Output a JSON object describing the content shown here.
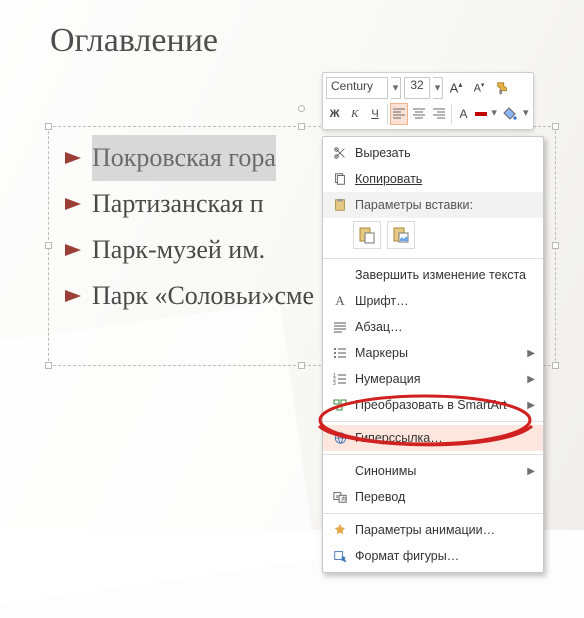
{
  "title": "Оглавление",
  "list": {
    "items": [
      {
        "text": "Покровская гора",
        "selected": true
      },
      {
        "text": "Партизанская п",
        "tail": ""
      },
      {
        "text": "Парк-музей им.",
        "tail": ""
      },
      {
        "text": "Парк «Соловьи»",
        "tail": "                                     сме"
      }
    ]
  },
  "mini_toolbar": {
    "font_name": "Century",
    "font_size": "32",
    "increase_font": "A",
    "decrease_font": "A",
    "bold": "Ж",
    "italic": "К",
    "underline": "Ч",
    "font_color": "#c00000",
    "highlight": "#ffff00"
  },
  "context_menu": {
    "cut": "Вырезать",
    "copy": "Копировать",
    "paste_header": "Параметры вставки:",
    "finish_edit": "Завершить изменение текста",
    "font": "Шрифт…",
    "paragraph": "Абзац…",
    "bullets": "Маркеры",
    "numbering": "Нумерация",
    "smartart": "Преобразовать в SmartArt",
    "hyperlink": "Гиперссылка…",
    "synonyms": "Синонимы",
    "translate": "Перевод",
    "anim": "Параметры анимации…",
    "format": "Формат фигуры…"
  }
}
